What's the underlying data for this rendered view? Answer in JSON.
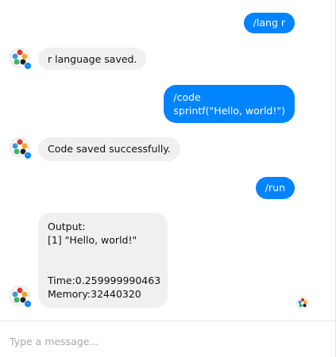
{
  "messages": [
    {
      "from": "user",
      "text": "/lang r"
    },
    {
      "from": "bot",
      "text": "r language saved."
    },
    {
      "from": "user",
      "lines": [
        "/code",
        "sprintf(\"Hello, world!\")"
      ]
    },
    {
      "from": "bot",
      "text": "Code saved successfully."
    },
    {
      "from": "user",
      "text": "/run"
    },
    {
      "from": "bot",
      "lines": [
        "Output:",
        "[1] \"Hello, world!\"",
        "Time:0.259999990463",
        "Memory:32440320"
      ]
    }
  ],
  "composer": {
    "placeholder": "Type a message..."
  },
  "colors": {
    "outgoing_bubble": "#0084ff",
    "incoming_bubble": "#f1f0f0",
    "messenger_badge": "#0084ff"
  },
  "icons": {
    "bot_avatar": "bot-avatar-icon",
    "seen_indicator": "seen-avatar-icon"
  }
}
